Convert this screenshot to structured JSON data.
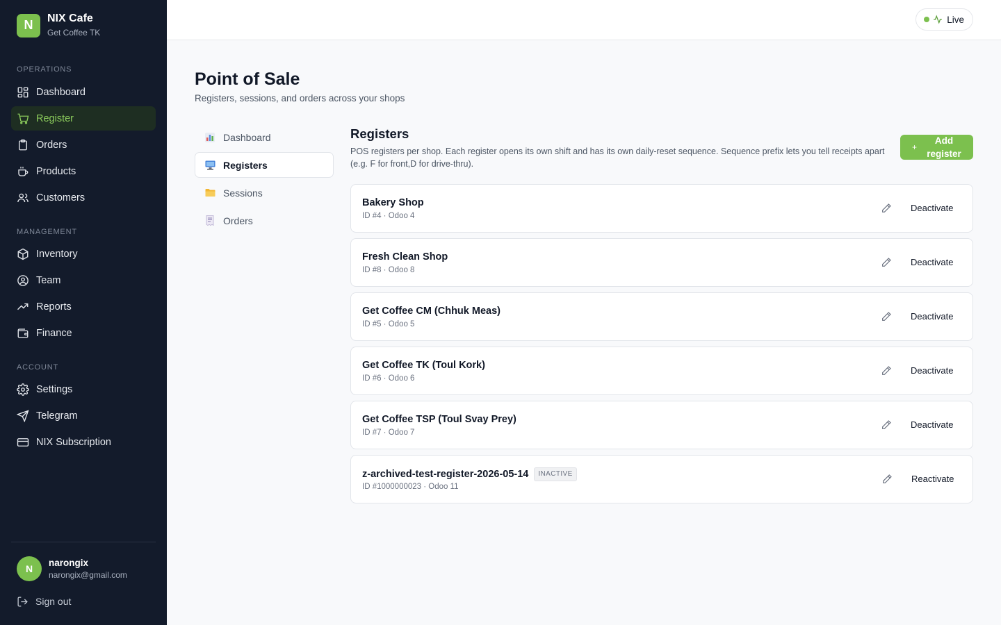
{
  "brand": {
    "logo_letter": "N",
    "name": "NIX Cafe",
    "subtitle": "Get Coffee TK"
  },
  "sidebar": {
    "sections": [
      {
        "heading": "OPERATIONS",
        "items": [
          {
            "label": "Dashboard",
            "icon": "grid-icon"
          },
          {
            "label": "Register",
            "icon": "cart-icon",
            "active": true
          },
          {
            "label": "Orders",
            "icon": "clipboard-icon"
          },
          {
            "label": "Products",
            "icon": "coffee-cup-icon"
          },
          {
            "label": "Customers",
            "icon": "users-icon"
          }
        ]
      },
      {
        "heading": "MANAGEMENT",
        "items": [
          {
            "label": "Inventory",
            "icon": "box-icon"
          },
          {
            "label": "Team",
            "icon": "user-circle-icon"
          },
          {
            "label": "Reports",
            "icon": "trending-up-icon"
          },
          {
            "label": "Finance",
            "icon": "wallet-icon"
          }
        ]
      },
      {
        "heading": "ACCOUNT",
        "items": [
          {
            "label": "Settings",
            "icon": "gear-icon"
          },
          {
            "label": "Telegram",
            "icon": "send-icon"
          },
          {
            "label": "NIX Subscription",
            "icon": "credit-card-icon"
          }
        ]
      }
    ],
    "user": {
      "initial": "N",
      "name": "narongix",
      "email": "narongix@gmail.com"
    },
    "signout_label": "Sign out"
  },
  "topbar": {
    "live_label": "Live",
    "accent": "#7cc04e"
  },
  "page": {
    "title": "Point of Sale",
    "subtitle": "Registers, sessions, and orders across your shops"
  },
  "subnav": [
    {
      "label": "Dashboard",
      "icon": "bar-chart-icon"
    },
    {
      "label": "Registers",
      "icon": "computer-icon",
      "active": true
    },
    {
      "label": "Sessions",
      "icon": "folder-icon"
    },
    {
      "label": "Orders",
      "icon": "receipt-icon"
    }
  ],
  "registers": {
    "title": "Registers",
    "description": "POS registers per shop. Each register opens its own shift and has its own daily-reset sequence. Sequence prefix lets you tell receipts apart (e.g. F for front,D for drive-thru).",
    "add_button_label": "Add register",
    "items": [
      {
        "name": "Bakery Shop",
        "meta": "ID #4 · Odoo 4",
        "action": "Deactivate"
      },
      {
        "name": "Fresh Clean Shop",
        "meta": "ID #8 · Odoo 8",
        "action": "Deactivate"
      },
      {
        "name": "Get Coffee CM (Chhuk Meas)",
        "meta": "ID #5 · Odoo 5",
        "action": "Deactivate"
      },
      {
        "name": "Get Coffee TK (Toul Kork)",
        "meta": "ID #6 · Odoo 6",
        "action": "Deactivate"
      },
      {
        "name": "Get Coffee TSP (Toul Svay Prey)",
        "meta": "ID #7 · Odoo 7",
        "action": "Deactivate"
      },
      {
        "name": "z-archived-test-register-2026-05-14",
        "badge": "INACTIVE",
        "meta": "ID #1000000023 · Odoo 11",
        "action": "Reactivate"
      }
    ]
  }
}
